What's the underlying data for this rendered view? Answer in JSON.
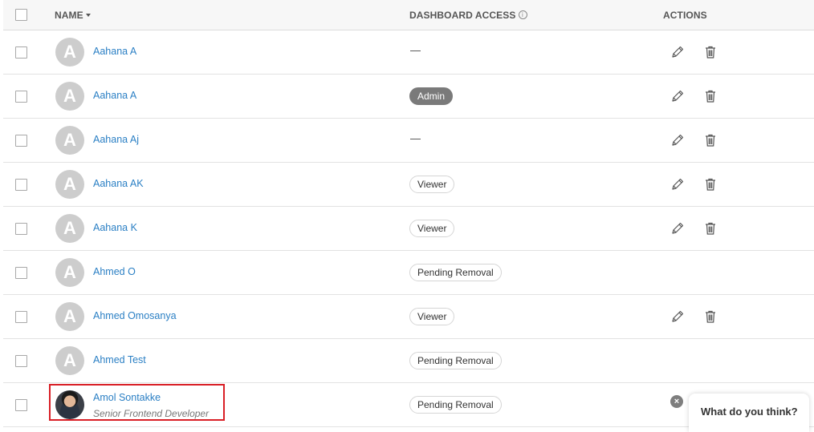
{
  "header": {
    "name_label": "NAME",
    "access_label": "DASHBOARD ACCESS",
    "actions_label": "ACTIONS",
    "info_glyph": "i"
  },
  "rows": [
    {
      "initial": "A",
      "name": "Aahana A",
      "access": "—",
      "access_type": "none",
      "actions": true
    },
    {
      "initial": "A",
      "name": "Aahana A",
      "access": "Admin",
      "access_type": "admin",
      "actions": true
    },
    {
      "initial": "A",
      "name": "Aahana Aj",
      "access": "—",
      "access_type": "none",
      "actions": true
    },
    {
      "initial": "A",
      "name": "Aahana AK",
      "access": "Viewer",
      "access_type": "pill",
      "actions": true
    },
    {
      "initial": "A",
      "name": "Aahana K",
      "access": "Viewer",
      "access_type": "pill",
      "actions": true
    },
    {
      "initial": "A",
      "name": "Ahmed O",
      "access": "Pending Removal",
      "access_type": "pill",
      "actions": false
    },
    {
      "initial": "A",
      "name": "Ahmed Omosanya",
      "access": "Viewer",
      "access_type": "pill",
      "actions": true
    },
    {
      "initial": "A",
      "name": "Ahmed Test",
      "access": "Pending Removal",
      "access_type": "pill",
      "actions": false
    },
    {
      "initial": "",
      "name": "Amol Sontakke",
      "subtitle": "Senior Frontend Developer",
      "access": "Pending Removal",
      "access_type": "pill",
      "actions": false,
      "photo": true
    }
  ],
  "feedback": {
    "label": "What do you think?",
    "close_glyph": "×"
  },
  "colors": {
    "link": "#2a7fc4",
    "highlight": "#d91f26",
    "admin_pill": "#7a7a7a"
  }
}
